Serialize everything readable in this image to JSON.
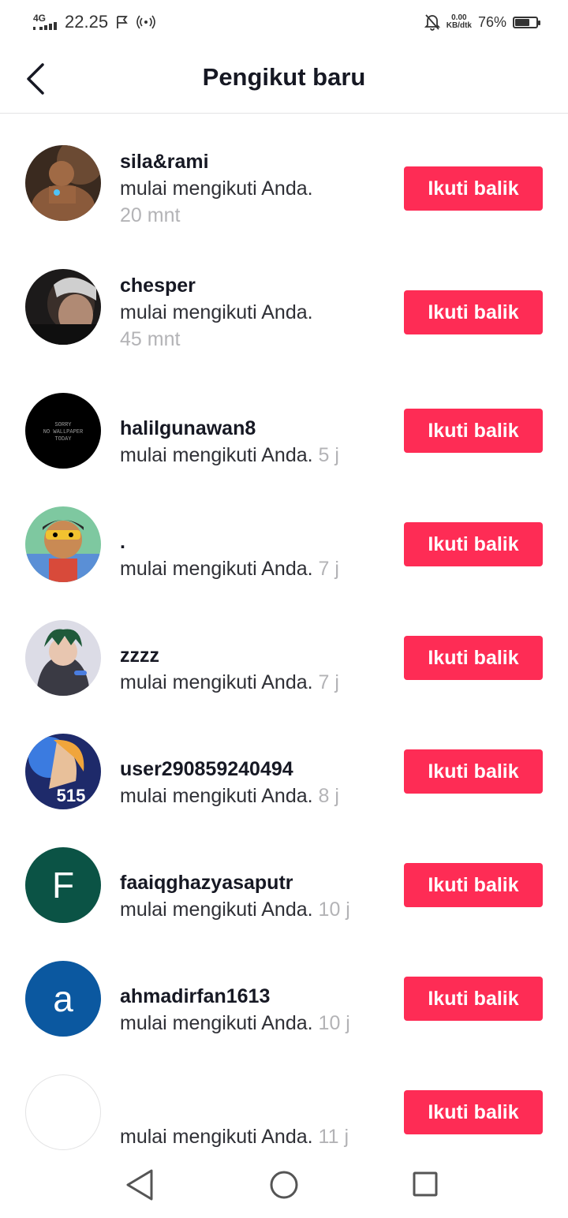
{
  "status_bar": {
    "network": "4G",
    "time": "22.25",
    "speed_value": "0.00",
    "speed_unit": "KB/dtk",
    "battery_pct": "76%",
    "battery_level": 0.76
  },
  "header": {
    "title": "Pengikut baru"
  },
  "follow_button_label": "Ikuti balik",
  "followers": [
    {
      "username": "sila&rami",
      "message": "mulai mengikuti Anda.",
      "time": "20 mnt",
      "avatar": "photo-warrior"
    },
    {
      "username": "chesper",
      "message": "mulai mengikuti Anda.",
      "time": "45 mnt",
      "avatar": "photo-person"
    },
    {
      "username": "halilgunawan8",
      "message": "mulai mengikuti Anda.",
      "time": "5 j",
      "avatar": "black-text",
      "avatar_text": [
        "SORRY",
        "NO WALLPAPER",
        "TODAY"
      ]
    },
    {
      "username": ".",
      "message": "mulai mengikuti Anda.",
      "time": "7 j",
      "avatar": "cartoon-boy"
    },
    {
      "username": "zzzz",
      "message": "mulai mengikuti Anda.",
      "time": "7 j",
      "avatar": "anime-hoodie"
    },
    {
      "username": "user290859240494",
      "message": "mulai mengikuti Anda.",
      "time": "8 j",
      "avatar": "game-character",
      "avatar_text": [
        "515"
      ]
    },
    {
      "username": "faaiqghazyasaputr",
      "message": "mulai mengikuti Anda.",
      "time": "10 j",
      "avatar": "letter",
      "avatar_letter": "F",
      "avatar_color": "#0b5345"
    },
    {
      "username": "ahmadirfan1613",
      "message": "mulai mengikuti Anda.",
      "time": "10 j",
      "avatar": "letter",
      "avatar_letter": "a",
      "avatar_color": "#0b58a0"
    },
    {
      "username": "",
      "message": "mulai mengikuti Anda.",
      "time": "11 j",
      "avatar": "empty"
    }
  ],
  "colors": {
    "accent": "#fe2c55",
    "text": "#161823",
    "muted": "#b3b3b6"
  }
}
